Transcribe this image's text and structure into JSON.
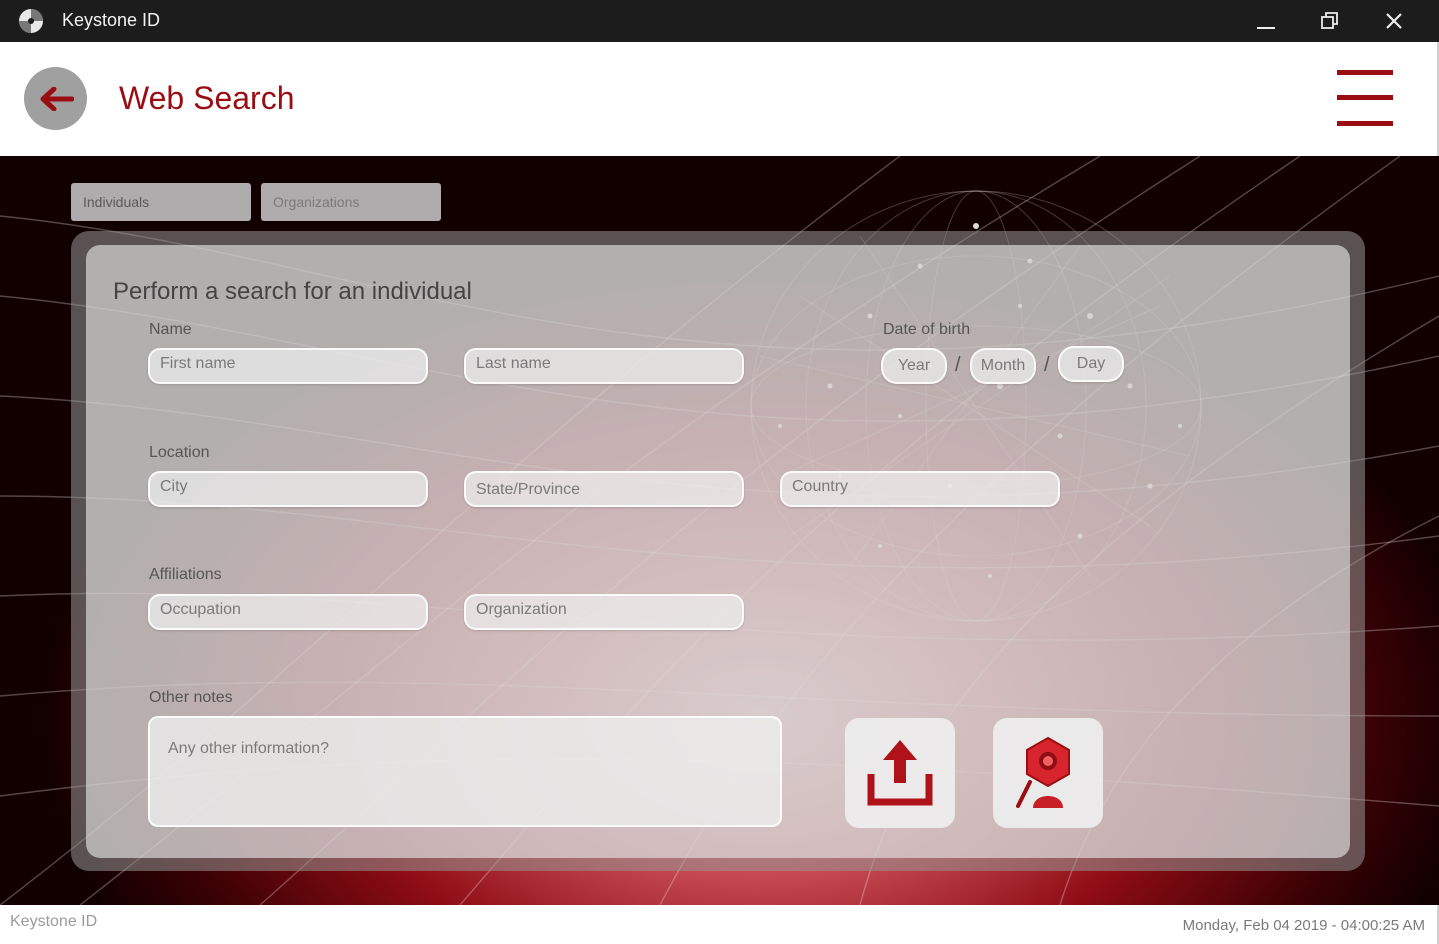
{
  "window": {
    "title": "Keystone ID"
  },
  "header": {
    "title": "Web Search"
  },
  "tabs": [
    {
      "label": "Individuals",
      "active": true
    },
    {
      "label": "Organizations",
      "active": false
    }
  ],
  "form": {
    "heading": "Perform a search for an individual",
    "name": {
      "label": "Name",
      "first_placeholder": "First name",
      "last_placeholder": "Last name"
    },
    "dob": {
      "label": "Date of birth",
      "year": "Year",
      "month": "Month",
      "day": "Day",
      "separator": "/"
    },
    "location": {
      "label": "Location",
      "city": "City",
      "state": "State/Province",
      "country": "Country"
    },
    "affiliations": {
      "label": "Affiliations",
      "occupation": "Occupation",
      "organization": "Organization"
    },
    "notes": {
      "label": "Other notes",
      "placeholder": "Any other information?"
    }
  },
  "actions": {
    "upload_icon": "upload-icon",
    "search_icon": "search-profile-icon"
  },
  "statusbar": {
    "app_name": "Keystone ID",
    "datetime": "Monday, Feb 04 2019 - 04:00:25 AM"
  },
  "colors": {
    "accent": "#9a0d12",
    "titlebar": "#1c1c1c"
  }
}
